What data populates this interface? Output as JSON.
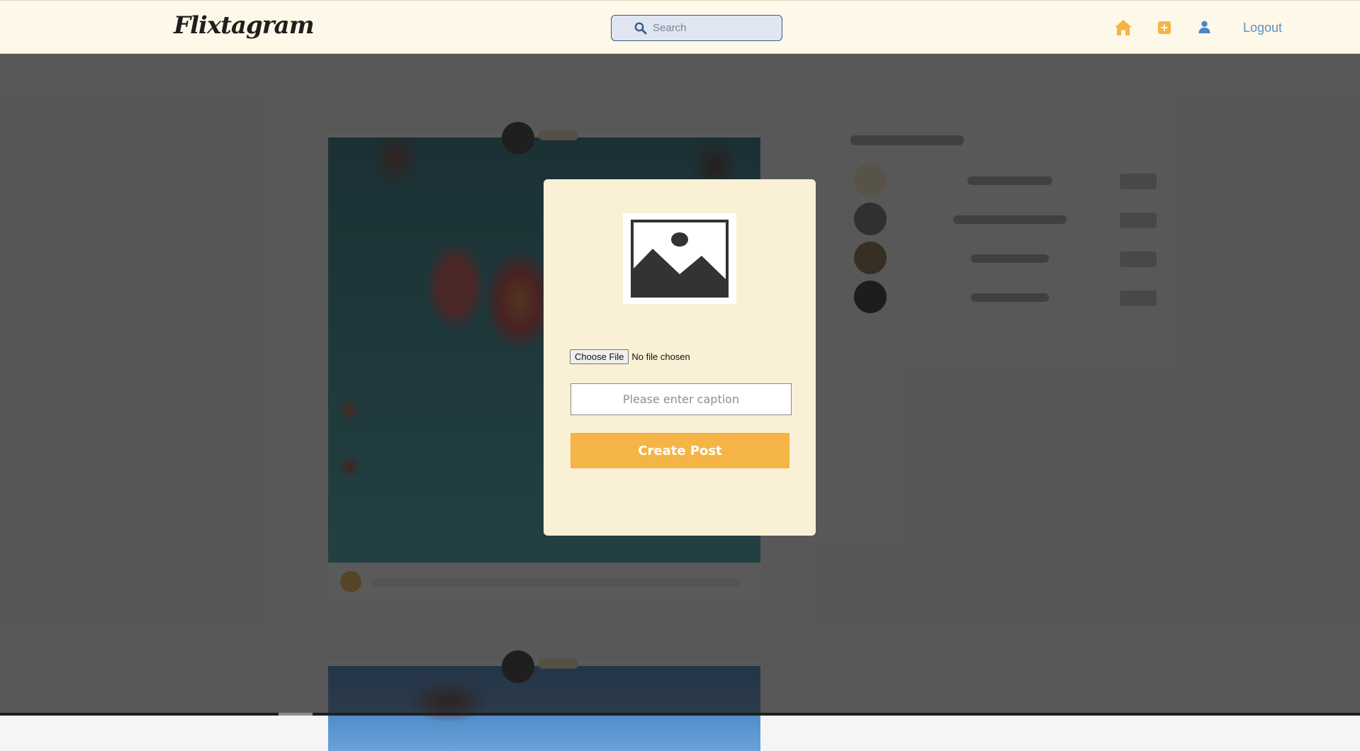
{
  "header": {
    "logo": "Flixtagram",
    "search_placeholder": "Search",
    "logout_label": "Logout",
    "icons": [
      "home-icon",
      "add-post-icon",
      "profile-icon"
    ],
    "accent_color": "#f4b446",
    "link_color": "#5f8fc4"
  },
  "modal": {
    "image_icon": "image-placeholder-icon",
    "choose_file_label": "Choose File",
    "no_file_text": "No file chosen",
    "caption_placeholder": "Please enter caption",
    "caption_value": "",
    "create_post_label": "Create Post",
    "background_color": "#faf0d6",
    "button_color": "#f4b446"
  }
}
